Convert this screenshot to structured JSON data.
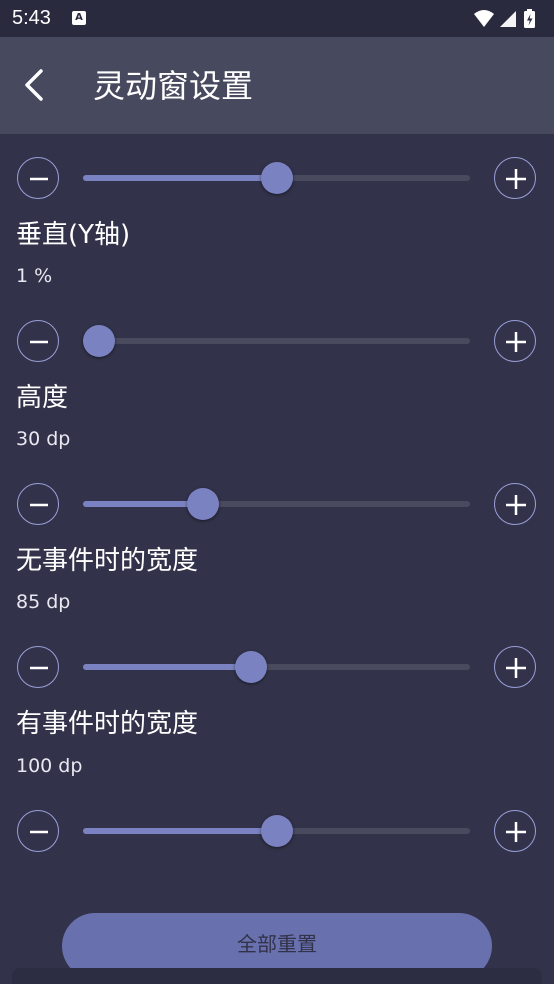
{
  "status_bar": {
    "time": "5:43",
    "notification_icon": "a-icon",
    "wifi_icon": "wifi-icon",
    "signal_icon": "signal-icon",
    "battery_icon": "battery-charging-icon"
  },
  "app_bar": {
    "back_icon": "chevron-left-icon",
    "title": "灵动窗设置"
  },
  "colors": {
    "background": "#32324a",
    "app_bar": "#474a5e",
    "accent": "#7b82c2",
    "track": "#4a4a5e"
  },
  "sliders": [
    {
      "label": "",
      "value_text": "",
      "fraction": 0.5
    },
    {
      "label": "垂直(Y轴)",
      "value_text": "1 %",
      "fraction": 0.02
    },
    {
      "label": "高度",
      "value_text": "30 dp",
      "fraction": 0.3
    },
    {
      "label": "无事件时的宽度",
      "value_text": "85 dp",
      "fraction": 0.43
    },
    {
      "label": "有事件时的宽度",
      "value_text": "100 dp",
      "fraction": 0.5
    }
  ],
  "reset_button": {
    "label": "全部重置"
  }
}
